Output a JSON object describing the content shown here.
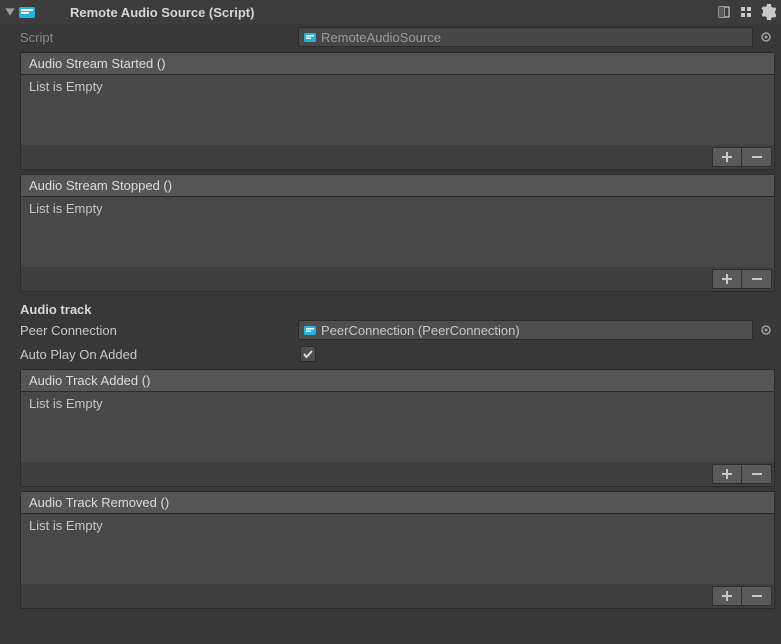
{
  "header": {
    "title": "Remote Audio Source (Script)"
  },
  "script": {
    "label": "Script",
    "value": "RemoteAudioSource"
  },
  "events": {
    "audioStreamStarted": {
      "title": "Audio Stream Started ()",
      "empty": "List is Empty"
    },
    "audioStreamStopped": {
      "title": "Audio Stream Stopped ()",
      "empty": "List is Empty"
    },
    "audioTrackAdded": {
      "title": "Audio Track Added ()",
      "empty": "List is Empty"
    },
    "audioTrackRemoved": {
      "title": "Audio Track Removed ()",
      "empty": "List is Empty"
    }
  },
  "audioTrack": {
    "sectionLabel": "Audio track",
    "peerConnection": {
      "label": "Peer Connection",
      "value": "PeerConnection (PeerConnection)"
    },
    "autoPlay": {
      "label": "Auto Play On Added",
      "checked": true
    }
  }
}
